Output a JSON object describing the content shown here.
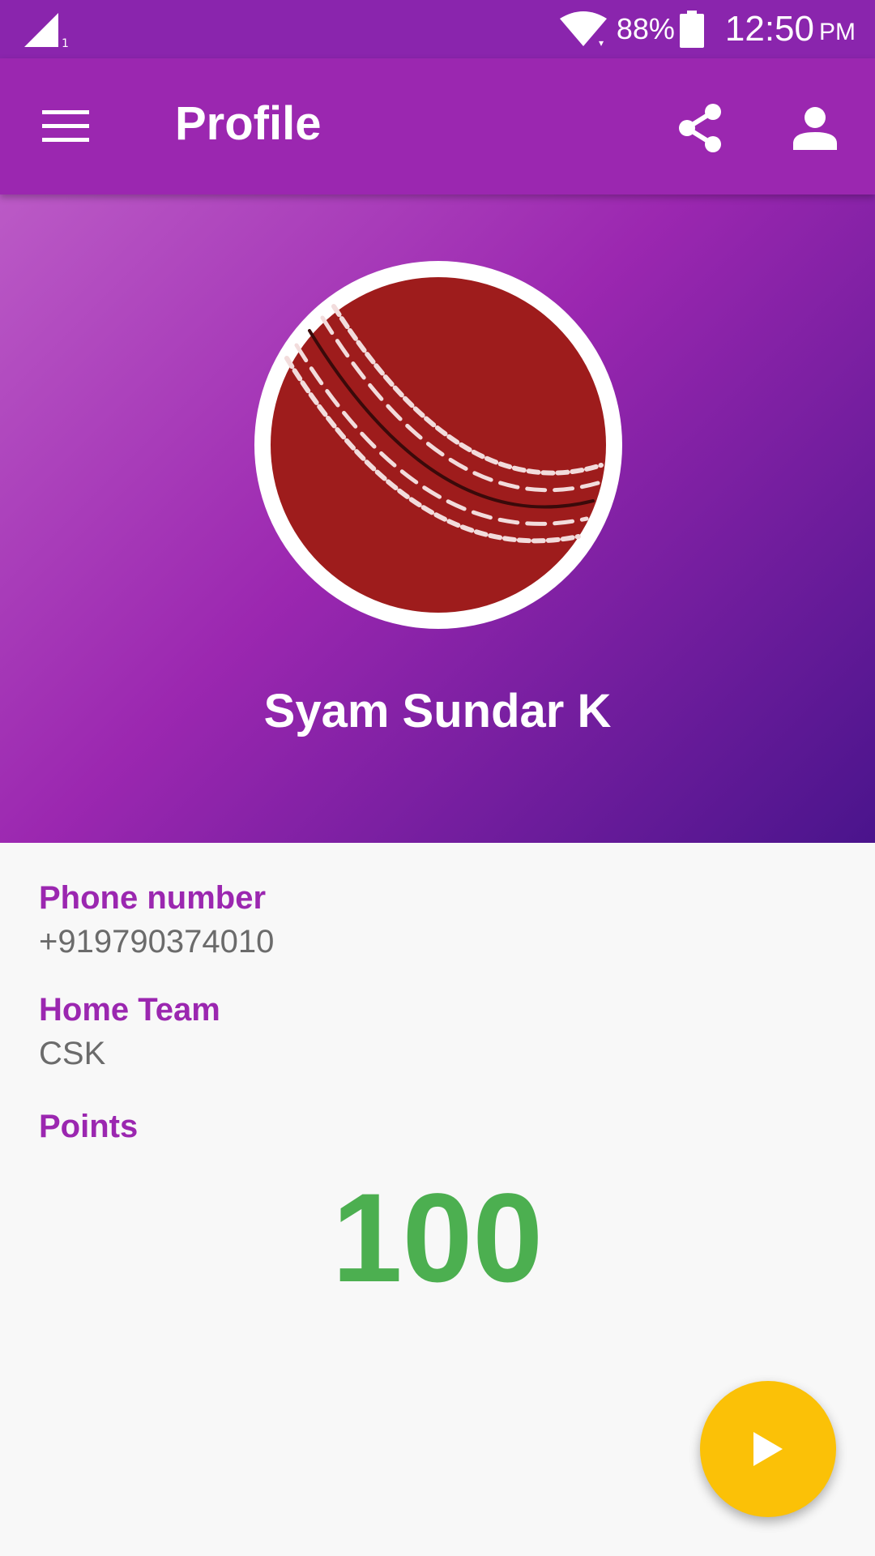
{
  "status_bar": {
    "battery_percent": "88%",
    "time": "12:50",
    "ampm": "PM",
    "icons": [
      "signal-icon",
      "wifi-icon",
      "battery-icon"
    ]
  },
  "app_bar": {
    "title": "Profile",
    "icons": [
      "menu-icon",
      "share-icon",
      "account-icon"
    ]
  },
  "profile": {
    "avatar_icon": "cricket-ball-icon",
    "name": "Syam Sundar K"
  },
  "details": {
    "phone_label": "Phone number",
    "phone_value": "+919790374010",
    "team_label": "Home Team",
    "team_value": "CSK",
    "points_label": "Points",
    "points_value": "100"
  },
  "fab": {
    "icon": "play-icon"
  },
  "colors": {
    "primary": "#9b27b0",
    "primary_dark": "#8a25ad",
    "accent": "#fbc107",
    "points": "#4caf50",
    "ball": "#9e1c1c"
  }
}
